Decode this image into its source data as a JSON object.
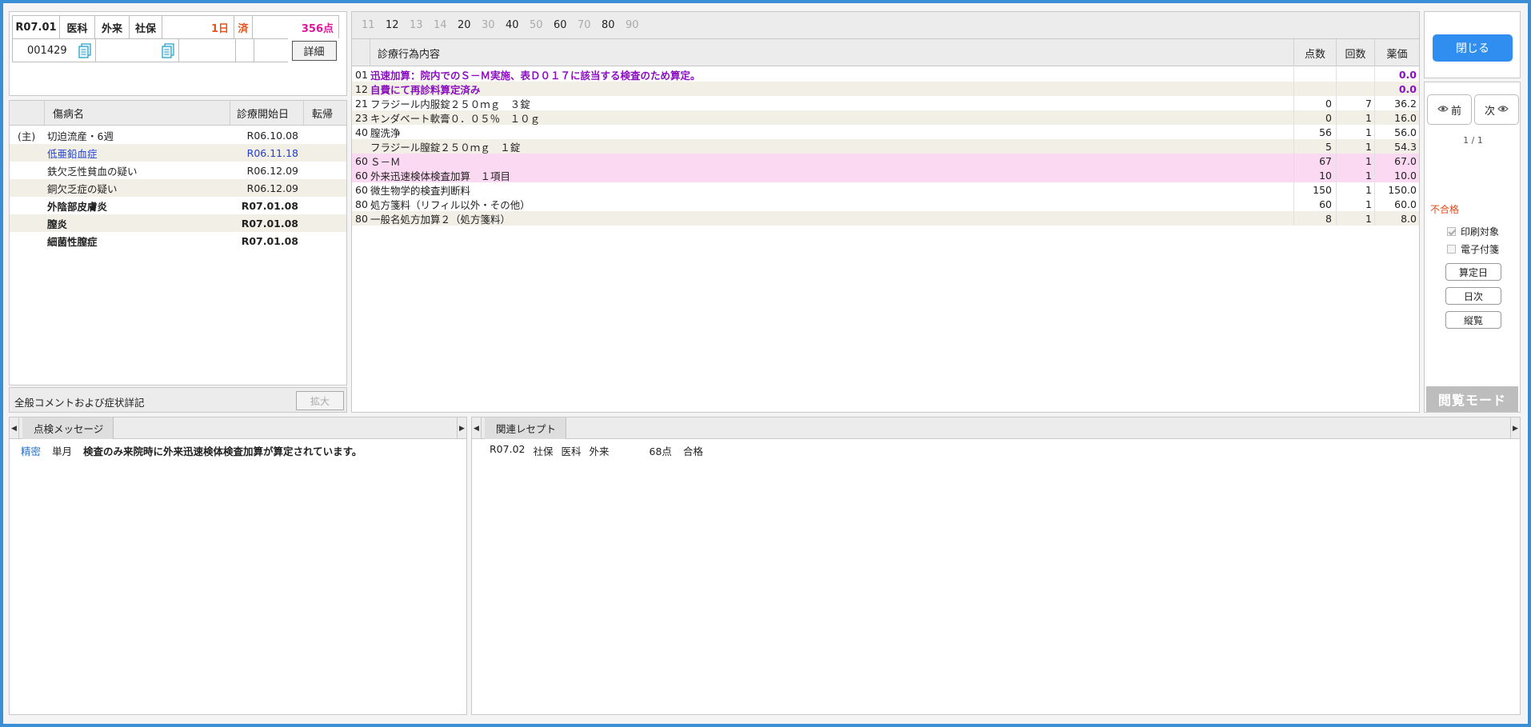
{
  "header": {
    "date": "R07.01",
    "dept": "医科",
    "visit": "外来",
    "insurance": "社保",
    "days": "1日",
    "status": "済",
    "points": "356点",
    "patient_id": "001429",
    "detail_label": "詳細",
    "icon": "document-copy-icon"
  },
  "disease_table": {
    "headers": [
      "",
      "傷病名",
      "診療開始日",
      "転帰"
    ],
    "rows": [
      {
        "prefix": "(主)",
        "name": "切迫流産・6週",
        "date": "R06.10.08",
        "style": "normal"
      },
      {
        "prefix": "",
        "name": "低亜鉛血症",
        "date": "R06.11.18",
        "style": "blue"
      },
      {
        "prefix": "",
        "name": "鉄欠乏性貧血の疑い",
        "date": "R06.12.09",
        "style": "normal"
      },
      {
        "prefix": "",
        "name": "銅欠乏症の疑い",
        "date": "R06.12.09",
        "style": "normal"
      },
      {
        "prefix": "",
        "name": "外陰部皮膚炎",
        "date": "R07.01.08",
        "style": "bold"
      },
      {
        "prefix": "",
        "name": "膣炎",
        "date": "R07.01.08",
        "style": "bold"
      },
      {
        "prefix": "",
        "name": "細菌性膣症",
        "date": "R07.01.08",
        "style": "bold"
      }
    ]
  },
  "comment": {
    "label": "全般コメントおよび症状詳記",
    "expand_label": "拡大"
  },
  "proc_tabs": [
    {
      "label": "11",
      "active": false
    },
    {
      "label": "12",
      "active": true
    },
    {
      "label": "13",
      "active": false
    },
    {
      "label": "14",
      "active": false
    },
    {
      "label": "20",
      "active": true
    },
    {
      "label": "30",
      "active": false
    },
    {
      "label": "40",
      "active": true
    },
    {
      "label": "50",
      "active": false
    },
    {
      "label": "60",
      "active": true
    },
    {
      "label": "70",
      "active": false
    },
    {
      "label": "80",
      "active": true
    },
    {
      "label": "90",
      "active": false
    }
  ],
  "proc_table": {
    "headers": {
      "content": "診療行為内容",
      "points": "点数",
      "count": "回数",
      "drug": "薬価"
    },
    "rows": [
      {
        "code": "01",
        "name": "迅速加算：院内でのＳ－Ｍ実施、表Ｄ０１７に該当する検査のため算定。",
        "points": "",
        "count": "",
        "drug": "0.0",
        "style": "purple"
      },
      {
        "code": "12",
        "name": "自費にて再診料算定済み",
        "points": "",
        "count": "",
        "drug": "0.0",
        "style": "purple alt"
      },
      {
        "code": "21",
        "name": "フラジール内服錠２５０ｍｇ　３錠",
        "points": "0",
        "count": "7",
        "drug": "36.2",
        "style": "normal"
      },
      {
        "code": "23",
        "name": "キンダベート軟膏０．０５％　１０ｇ",
        "points": "0",
        "count": "1",
        "drug": "16.0",
        "style": "alt"
      },
      {
        "code": "40",
        "name": "膣洗浄",
        "points": "56",
        "count": "1",
        "drug": "56.0",
        "style": "normal"
      },
      {
        "code": "",
        "name": "フラジール膣錠２５０ｍｇ　１錠",
        "points": "5",
        "count": "1",
        "drug": "54.3",
        "style": "alt"
      },
      {
        "code": "60",
        "name": "Ｓ－Ｍ",
        "points": "67",
        "count": "1",
        "drug": "67.0",
        "style": "pink"
      },
      {
        "code": "60",
        "name": "外来迅速検体検査加算　１項目",
        "points": "10",
        "count": "1",
        "drug": "10.0",
        "style": "pink"
      },
      {
        "code": "60",
        "name": "微生物学的検査判断料",
        "points": "150",
        "count": "1",
        "drug": "150.0",
        "style": "normal"
      },
      {
        "code": "80",
        "name": "処方箋料（リフィル以外・その他）",
        "points": "60",
        "count": "1",
        "drug": "60.0",
        "style": "normal"
      },
      {
        "code": "80",
        "name": "一般名処方加算２（処方箋料）",
        "points": "8",
        "count": "1",
        "drug": "8.0",
        "style": "alt"
      }
    ]
  },
  "side": {
    "close_label": "閉じる",
    "prev_label": "前",
    "next_label": "次",
    "page": "1 / 1",
    "result": "不合格",
    "print_label": "印刷対象",
    "print_checked": true,
    "attach_label": "電子付箋",
    "attach_checked": false,
    "calc_day_label": "算定日",
    "daily_label": "日次",
    "overview_label": "縦覧",
    "mode_label": "閲覧モード"
  },
  "check_panel": {
    "tab_label": "点検メッセージ",
    "messages": [
      {
        "level": "精密",
        "scope": "単月",
        "text": "検査のみ来院時に外来迅速検体検査加算が算定されています。"
      }
    ]
  },
  "related_panel": {
    "tab_label": "関連レセプト",
    "items": [
      {
        "date": "R07.02",
        "insurance": "社保",
        "dept": "医科",
        "visit": "外来",
        "points": "68点",
        "result": "合格"
      }
    ]
  },
  "colors": {
    "frame": "#3a8fd6",
    "accent_blue": "#2f8ef0",
    "purple": "#8a10c0",
    "pink_row": "#fbd9f2",
    "alt_row": "#f1efe6",
    "warn_orange": "#e8541a",
    "points_magenta": "#e0169a",
    "result_fail": "#e04a1a"
  }
}
